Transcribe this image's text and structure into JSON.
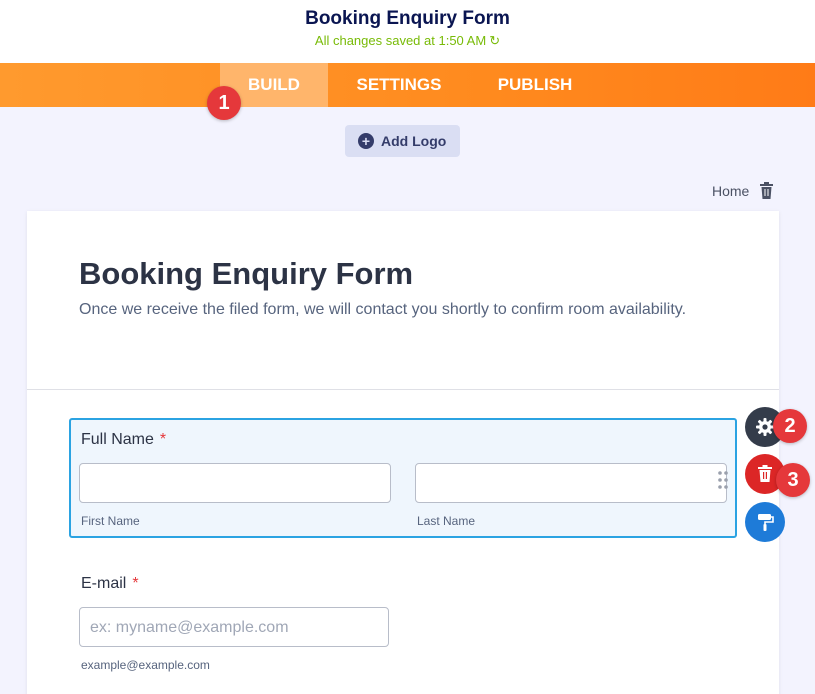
{
  "header": {
    "title": "Booking Enquiry Form",
    "saved_status": "All changes saved at 1:50 AM",
    "refresh_icon": "refresh-icon"
  },
  "nav": {
    "tabs": [
      {
        "label": "BUILD",
        "active": true
      },
      {
        "label": "SETTINGS",
        "active": false
      },
      {
        "label": "PUBLISH",
        "active": false
      }
    ],
    "accent": "#ff8a1e"
  },
  "badges": [
    "1",
    "2",
    "3"
  ],
  "toolbar": {
    "add_logo_label": "Add Logo",
    "home_label": "Home"
  },
  "form": {
    "title": "Booking Enquiry Form",
    "subtitle": "Once we receive the filed form, we will contact you shortly to confirm room availability.",
    "full_name": {
      "label": "Full Name",
      "required_mark": "*",
      "first_sublabel": "First Name",
      "last_sublabel": "Last Name",
      "first_value": "",
      "last_value": ""
    },
    "email": {
      "label": "E-mail",
      "required_mark": "*",
      "placeholder": "ex: myname@example.com",
      "sublabel": "example@example.com",
      "value": ""
    }
  },
  "side_actions": [
    {
      "name": "settings",
      "icon": "gear-icon",
      "color": "#343c4a"
    },
    {
      "name": "delete",
      "icon": "trash-icon",
      "color": "#dc2626"
    },
    {
      "name": "style",
      "icon": "paint-roller-icon",
      "color": "#1e7bd8"
    }
  ]
}
